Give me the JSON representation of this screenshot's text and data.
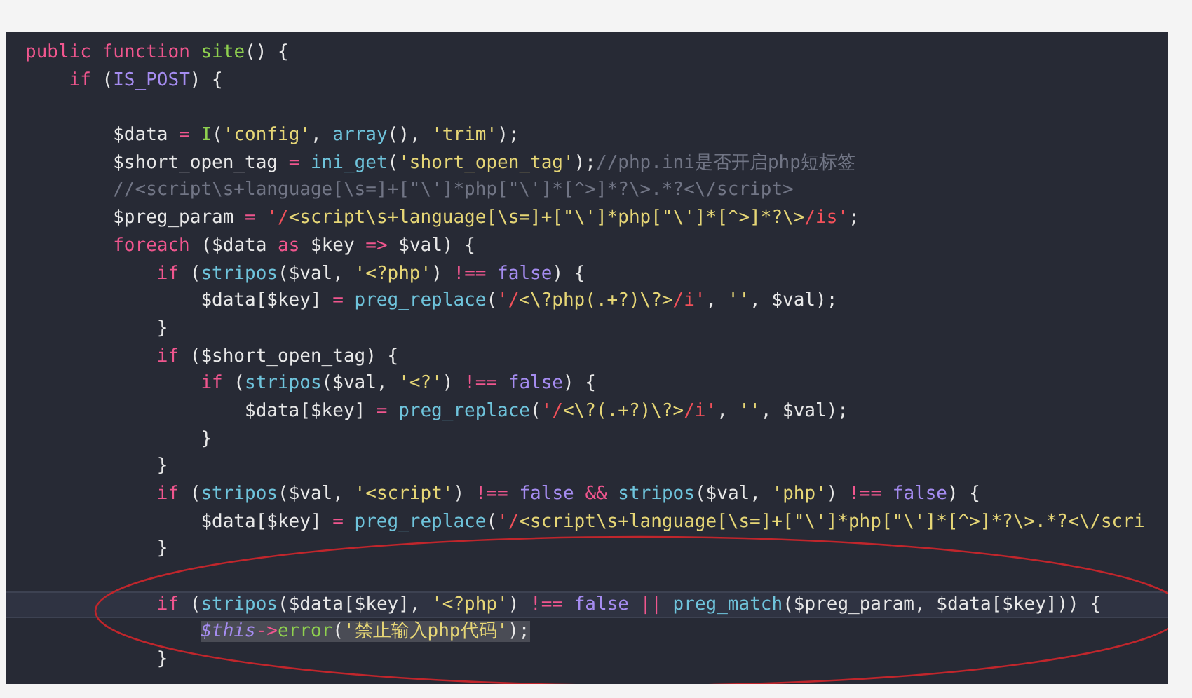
{
  "editor": {
    "annotation": {
      "kind": "ellipse"
    },
    "lines": [
      {
        "current": false,
        "selected": false,
        "tokens": [
          {
            "kind": "kw",
            "text": "public function"
          },
          {
            "kind": "def",
            "text": " site"
          },
          {
            "kind": "p",
            "text": "() {"
          }
        ],
        "children": [
          {
            "current": false,
            "selected": false,
            "tokens": [
              {
                "kind": "kw",
                "text": "if"
              },
              {
                "kind": "p",
                "text": " ("
              },
              {
                "kind": "const",
                "text": "IS_POST"
              },
              {
                "kind": "p",
                "text": ") {"
              }
            ],
            "children": [
              {
                "current": false,
                "selected": false
              },
              {
                "current": false,
                "selected": false,
                "tokens": [
                  {
                    "kind": "p",
                    "text": "$data "
                  },
                  {
                    "kind": "op",
                    "text": "="
                  },
                  {
                    "kind": "def",
                    "text": " I"
                  },
                  {
                    "kind": "p",
                    "text": "("
                  },
                  {
                    "kind": "str",
                    "text": "'config'"
                  },
                  {
                    "kind": "p",
                    "text": ", "
                  },
                  {
                    "kind": "call",
                    "text": "array"
                  },
                  {
                    "kind": "p",
                    "text": "(), "
                  },
                  {
                    "kind": "str",
                    "text": "'trim'"
                  },
                  {
                    "kind": "p",
                    "text": ");"
                  }
                ]
              },
              {
                "current": false,
                "selected": false,
                "tokens": [
                  {
                    "kind": "p",
                    "text": "$short_open_tag "
                  },
                  {
                    "kind": "op",
                    "text": "="
                  },
                  {
                    "kind": "call",
                    "text": " ini_get"
                  },
                  {
                    "kind": "p",
                    "text": "("
                  },
                  {
                    "kind": "str",
                    "text": "'short_open_tag'"
                  },
                  {
                    "kind": "p",
                    "text": ");"
                  },
                  {
                    "kind": "cm",
                    "text": "//php.ini是否开启php短标签"
                  }
                ]
              },
              {
                "current": false,
                "selected": false,
                "tokens": [
                  {
                    "kind": "cm",
                    "text": "//<script\\s+language[\\s=]+[\"\\']*php[\"\\']*[^>]*?\\>.*?<\\/script>"
                  }
                ]
              },
              {
                "current": false,
                "selected": false,
                "tokens": [
                  {
                    "kind": "p",
                    "text": "$preg_param "
                  },
                  {
                    "kind": "op",
                    "text": "="
                  },
                  {
                    "kind": "rx",
                    "text": " '/"
                  },
                  {
                    "kind": "str",
                    "text": "<script\\s+language[\\s=]+[\"\\']*php[\"\\']*[^>]*?\\>"
                  },
                  {
                    "kind": "rx",
                    "text": "/is'"
                  },
                  {
                    "kind": "p",
                    "text": ";"
                  }
                ]
              },
              {
                "current": false,
                "selected": false,
                "tokens": [
                  {
                    "kind": "kw",
                    "text": "foreach"
                  },
                  {
                    "kind": "p",
                    "text": " ($data "
                  },
                  {
                    "kind": "kw",
                    "text": "as"
                  },
                  {
                    "kind": "p",
                    "text": " $key "
                  },
                  {
                    "kind": "op",
                    "text": "=>"
                  },
                  {
                    "kind": "p",
                    "text": " $val) {"
                  }
                ],
                "children": [
                  {
                    "current": false,
                    "selected": false,
                    "tokens": [
                      {
                        "kind": "kw",
                        "text": "if"
                      },
                      {
                        "kind": "p",
                        "text": " ("
                      },
                      {
                        "kind": "call",
                        "text": "stripos"
                      },
                      {
                        "kind": "p",
                        "text": "($val, "
                      },
                      {
                        "kind": "str",
                        "text": "'<?php'"
                      },
                      {
                        "kind": "p",
                        "text": ") "
                      },
                      {
                        "kind": "op",
                        "text": "!=="
                      },
                      {
                        "kind": "const",
                        "text": " false"
                      },
                      {
                        "kind": "p",
                        "text": ") {"
                      }
                    ],
                    "children": [
                      {
                        "current": false,
                        "selected": false,
                        "tokens": [
                          {
                            "kind": "p",
                            "text": "$data[$key] "
                          },
                          {
                            "kind": "op",
                            "text": "="
                          },
                          {
                            "kind": "call",
                            "text": " preg_replace"
                          },
                          {
                            "kind": "p",
                            "text": "("
                          },
                          {
                            "kind": "rx",
                            "text": "'/"
                          },
                          {
                            "kind": "str",
                            "text": "<\\?php(.+?)\\?>"
                          },
                          {
                            "kind": "rx",
                            "text": "/i'"
                          },
                          {
                            "kind": "p",
                            "text": ", "
                          },
                          {
                            "kind": "str",
                            "text": "''"
                          },
                          {
                            "kind": "p",
                            "text": ", $val);"
                          }
                        ]
                      }
                    ]
                  },
                  {
                    "current": false,
                    "selected": false,
                    "tokens": [
                      {
                        "kind": "p",
                        "text": "}"
                      }
                    ]
                  },
                  {
                    "current": false,
                    "selected": false,
                    "tokens": [
                      {
                        "kind": "kw",
                        "text": "if"
                      },
                      {
                        "kind": "p",
                        "text": " ($short_open_tag) {"
                      }
                    ],
                    "children": [
                      {
                        "current": false,
                        "selected": false,
                        "tokens": [
                          {
                            "kind": "kw",
                            "text": "if"
                          },
                          {
                            "kind": "p",
                            "text": " ("
                          },
                          {
                            "kind": "call",
                            "text": "stripos"
                          },
                          {
                            "kind": "p",
                            "text": "($val, "
                          },
                          {
                            "kind": "str",
                            "text": "'<?'"
                          },
                          {
                            "kind": "p",
                            "text": ") "
                          },
                          {
                            "kind": "op",
                            "text": "!=="
                          },
                          {
                            "kind": "const",
                            "text": " false"
                          },
                          {
                            "kind": "p",
                            "text": ") {"
                          }
                        ],
                        "children": [
                          {
                            "current": false,
                            "selected": false,
                            "tokens": [
                              {
                                "kind": "p",
                                "text": "$data[$key] "
                              },
                              {
                                "kind": "op",
                                "text": "="
                              },
                              {
                                "kind": "call",
                                "text": " preg_replace"
                              },
                              {
                                "kind": "p",
                                "text": "("
                              },
                              {
                                "kind": "rx",
                                "text": "'/"
                              },
                              {
                                "kind": "str",
                                "text": "<\\?(.+?)\\?>"
                              },
                              {
                                "kind": "rx",
                                "text": "/i'"
                              },
                              {
                                "kind": "p",
                                "text": ", "
                              },
                              {
                                "kind": "str",
                                "text": "''"
                              },
                              {
                                "kind": "p",
                                "text": ", $val);"
                              }
                            ]
                          }
                        ]
                      },
                      {
                        "current": false,
                        "selected": false,
                        "tokens": [
                          {
                            "kind": "p",
                            "text": "}"
                          }
                        ]
                      }
                    ]
                  },
                  {
                    "current": false,
                    "selected": false,
                    "tokens": [
                      {
                        "kind": "p",
                        "text": "}"
                      }
                    ]
                  },
                  {
                    "current": false,
                    "selected": false,
                    "tokens": [
                      {
                        "kind": "kw",
                        "text": "if"
                      },
                      {
                        "kind": "p",
                        "text": " ("
                      },
                      {
                        "kind": "call",
                        "text": "stripos"
                      },
                      {
                        "kind": "p",
                        "text": "($val, "
                      },
                      {
                        "kind": "str",
                        "text": "'<script'"
                      },
                      {
                        "kind": "p",
                        "text": ") "
                      },
                      {
                        "kind": "op",
                        "text": "!=="
                      },
                      {
                        "kind": "const",
                        "text": " false "
                      },
                      {
                        "kind": "op",
                        "text": "&&"
                      },
                      {
                        "kind": "call",
                        "text": " stripos"
                      },
                      {
                        "kind": "p",
                        "text": "($val, "
                      },
                      {
                        "kind": "str",
                        "text": "'php'"
                      },
                      {
                        "kind": "p",
                        "text": ") "
                      },
                      {
                        "kind": "op",
                        "text": "!=="
                      },
                      {
                        "kind": "const",
                        "text": " false"
                      },
                      {
                        "kind": "p",
                        "text": ") {"
                      }
                    ],
                    "children": [
                      {
                        "current": false,
                        "selected": false,
                        "tokens": [
                          {
                            "kind": "p",
                            "text": "$data[$key] "
                          },
                          {
                            "kind": "op",
                            "text": "="
                          },
                          {
                            "kind": "call",
                            "text": " preg_replace"
                          },
                          {
                            "kind": "p",
                            "text": "("
                          },
                          {
                            "kind": "rx",
                            "text": "'/"
                          },
                          {
                            "kind": "str",
                            "text": "<script\\s+language[\\s=]+[\"\\']*php[\"\\']*[^>]*?\\>.*?<\\/scri"
                          }
                        ]
                      }
                    ]
                  },
                  {
                    "current": false,
                    "selected": false,
                    "tokens": [
                      {
                        "kind": "p",
                        "text": "}"
                      }
                    ]
                  },
                  {
                    "current": false,
                    "selected": false
                  },
                  {
                    "current": true,
                    "selected": false,
                    "tokens": [
                      {
                        "kind": "kw",
                        "text": "if"
                      },
                      {
                        "kind": "p",
                        "text": " ("
                      },
                      {
                        "kind": "call",
                        "text": "stripos"
                      },
                      {
                        "kind": "p",
                        "text": "($data[$key], "
                      },
                      {
                        "kind": "str",
                        "text": "'<?php'"
                      },
                      {
                        "kind": "p",
                        "text": ") "
                      },
                      {
                        "kind": "op",
                        "text": "!=="
                      },
                      {
                        "kind": "const",
                        "text": " false "
                      },
                      {
                        "kind": "op",
                        "text": "||"
                      },
                      {
                        "kind": "call",
                        "text": " preg_match"
                      },
                      {
                        "kind": "p",
                        "text": "($preg_param, $data[$key])) {"
                      }
                    ],
                    "children": [
                      {
                        "current": false,
                        "selected": true,
                        "tokens": [
                          {
                            "kind": "this",
                            "text": "$this"
                          },
                          {
                            "kind": "op",
                            "text": "->"
                          },
                          {
                            "kind": "def",
                            "text": "error"
                          },
                          {
                            "kind": "p",
                            "text": "("
                          },
                          {
                            "kind": "str",
                            "text": "'禁止输入php代码'"
                          },
                          {
                            "kind": "p",
                            "text": ");"
                          }
                        ]
                      }
                    ]
                  },
                  {
                    "current": false,
                    "selected": false,
                    "tokens": [
                      {
                        "kind": "p",
                        "text": "}"
                      }
                    ]
                  }
                ]
              }
            ]
          }
        ]
      }
    ]
  }
}
